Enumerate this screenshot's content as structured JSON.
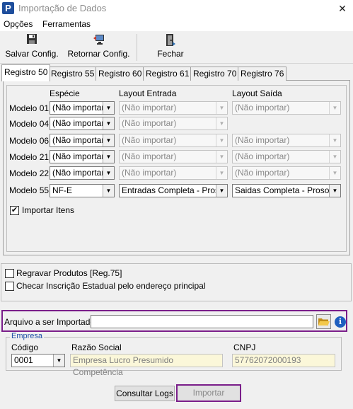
{
  "window": {
    "title": "Importação de Dados",
    "app_letter": "P",
    "close_glyph": "✕"
  },
  "menu": [
    "Opções",
    "Ferramentas"
  ],
  "toolbar": {
    "save_label": "Salvar Config.",
    "return_label": "Retornar Config.",
    "close_label": "Fechar"
  },
  "tabs": [
    "Registro 50",
    "Registro 55",
    "Registro 60",
    "Registro 61",
    "Registro 70",
    "Registro 76"
  ],
  "active_tab": "Registro 50",
  "grid": {
    "headers": {
      "especie": "Espécie",
      "layout_entrada": "Layout Entrada",
      "layout_saida": "Layout Saída"
    },
    "rows": [
      {
        "label": "Modelo 01",
        "especie": "(Não importar)",
        "entrada": "(Não importar)",
        "saida": "(Não importar)"
      },
      {
        "label": "Modelo 04",
        "especie": "(Não importar)",
        "entrada": "(Não importar)",
        "saida": ""
      },
      {
        "label": "Modelo 06",
        "especie": "(Não importar)",
        "entrada": "(Não importar)",
        "saida": "(Não importar)"
      },
      {
        "label": "Modelo 21",
        "especie": "(Não importar)",
        "entrada": "(Não importar)",
        "saida": "(Não importar)"
      },
      {
        "label": "Modelo 22",
        "especie": "(Não importar)",
        "entrada": "(Não importar)",
        "saida": "(Não importar)"
      },
      {
        "label": "Modelo 55",
        "especie": "NF-E",
        "entrada": "Entradas Completa - Prosof",
        "saida": "Saidas Completa - Prosoft"
      }
    ]
  },
  "importar_itens": {
    "label": "Importar Itens",
    "checked": true,
    "mark": "✔"
  },
  "options": {
    "regravar_label": "Regravar Produtos [Reg.75]",
    "checar_label": "Checar Inscrição Estadual pelo endereço principal"
  },
  "arquivo": {
    "label": "Arquivo a ser Importado",
    "value": ""
  },
  "empresa": {
    "legend": "Empresa",
    "codigo_label": "Código",
    "codigo_value": "0001",
    "razao_label": "Razão Social",
    "razao_value": "Empresa Lucro Presumido Competência",
    "cnpj_label": "CNPJ",
    "cnpj_value": "57762072000193"
  },
  "buttons": {
    "consultar_logs": "Consultar Logs",
    "importar": "Importar"
  },
  "icons": {
    "save": "floppy-disk-icon",
    "return": "computer-restore-icon",
    "close": "door-exit-icon",
    "folder": "folder-open-icon",
    "info": "info-icon",
    "info_glyph": "i",
    "combo_arrow": "▼"
  },
  "colors": {
    "highlight": "#7a1e8a",
    "legend": "#1f4fa6",
    "readonly_bg": "#fbf7d9",
    "app_icon": "#1e4e9c"
  }
}
